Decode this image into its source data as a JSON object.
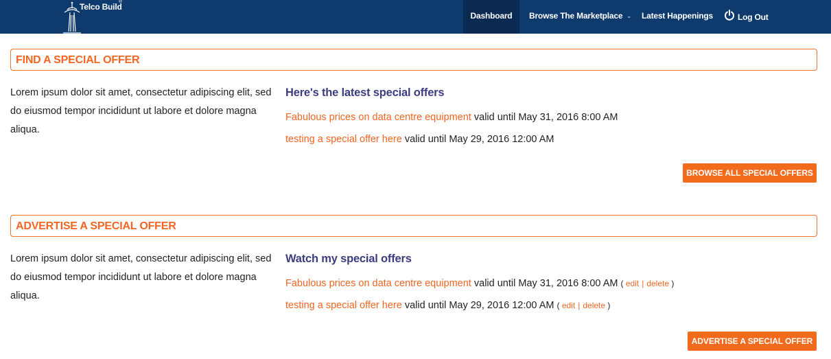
{
  "navbar": {
    "logo_text": "Telco Build",
    "logo_reg": "®",
    "items": [
      {
        "label": "Dashboard",
        "active": true
      },
      {
        "label": "Browse The Marketplace",
        "caret": "⌄"
      },
      {
        "label": "Latest Happenings"
      },
      {
        "label": "Log Out",
        "icon": "power-icon"
      }
    ]
  },
  "find_section": {
    "title": "FIND A SPECIAL OFFER",
    "description": "Lorem ipsum dolor sit amet, consectetur adipiscing elit, sed do eiusmod tempor incididunt ut labore et dolore magna aliqua.",
    "subheading": "Here's the latest special offers",
    "offers": [
      {
        "title": "Fabulous prices on data centre equipment",
        "valid": "valid until May 31, 2016 8:00 AM"
      },
      {
        "title": "testing a special offer here",
        "valid": "valid until May 29, 2016 12:00 AM"
      }
    ],
    "button": "BROWSE ALL SPECIAL OFFERS"
  },
  "advertise_section": {
    "title": "ADVERTISE A SPECIAL OFFER",
    "description": "Lorem ipsum dolor sit amet, consectetur adipiscing elit, sed do eiusmod tempor incididunt ut labore et dolore magna aliqua.",
    "subheading": "Watch my special offers",
    "offers": [
      {
        "title": "Fabulous prices on data centre equipment",
        "valid": "valid until May 31, 2016 8:00 AM",
        "open": "(",
        "edit": "edit",
        "sep": "|",
        "delete": "delete",
        "close": ")"
      },
      {
        "title": "testing a special offer here",
        "valid": "valid until May 29, 2016 12:00 AM",
        "open": "(",
        "edit": "edit",
        "sep": "|",
        "delete": "delete",
        "close": ")"
      }
    ],
    "button": "ADVERTISE A SPECIAL OFFER"
  },
  "colors": {
    "navbar": "#0e3a6e",
    "navbar_active": "#0a2a52",
    "accent": "#f26522",
    "subheading": "#3c3c80"
  }
}
